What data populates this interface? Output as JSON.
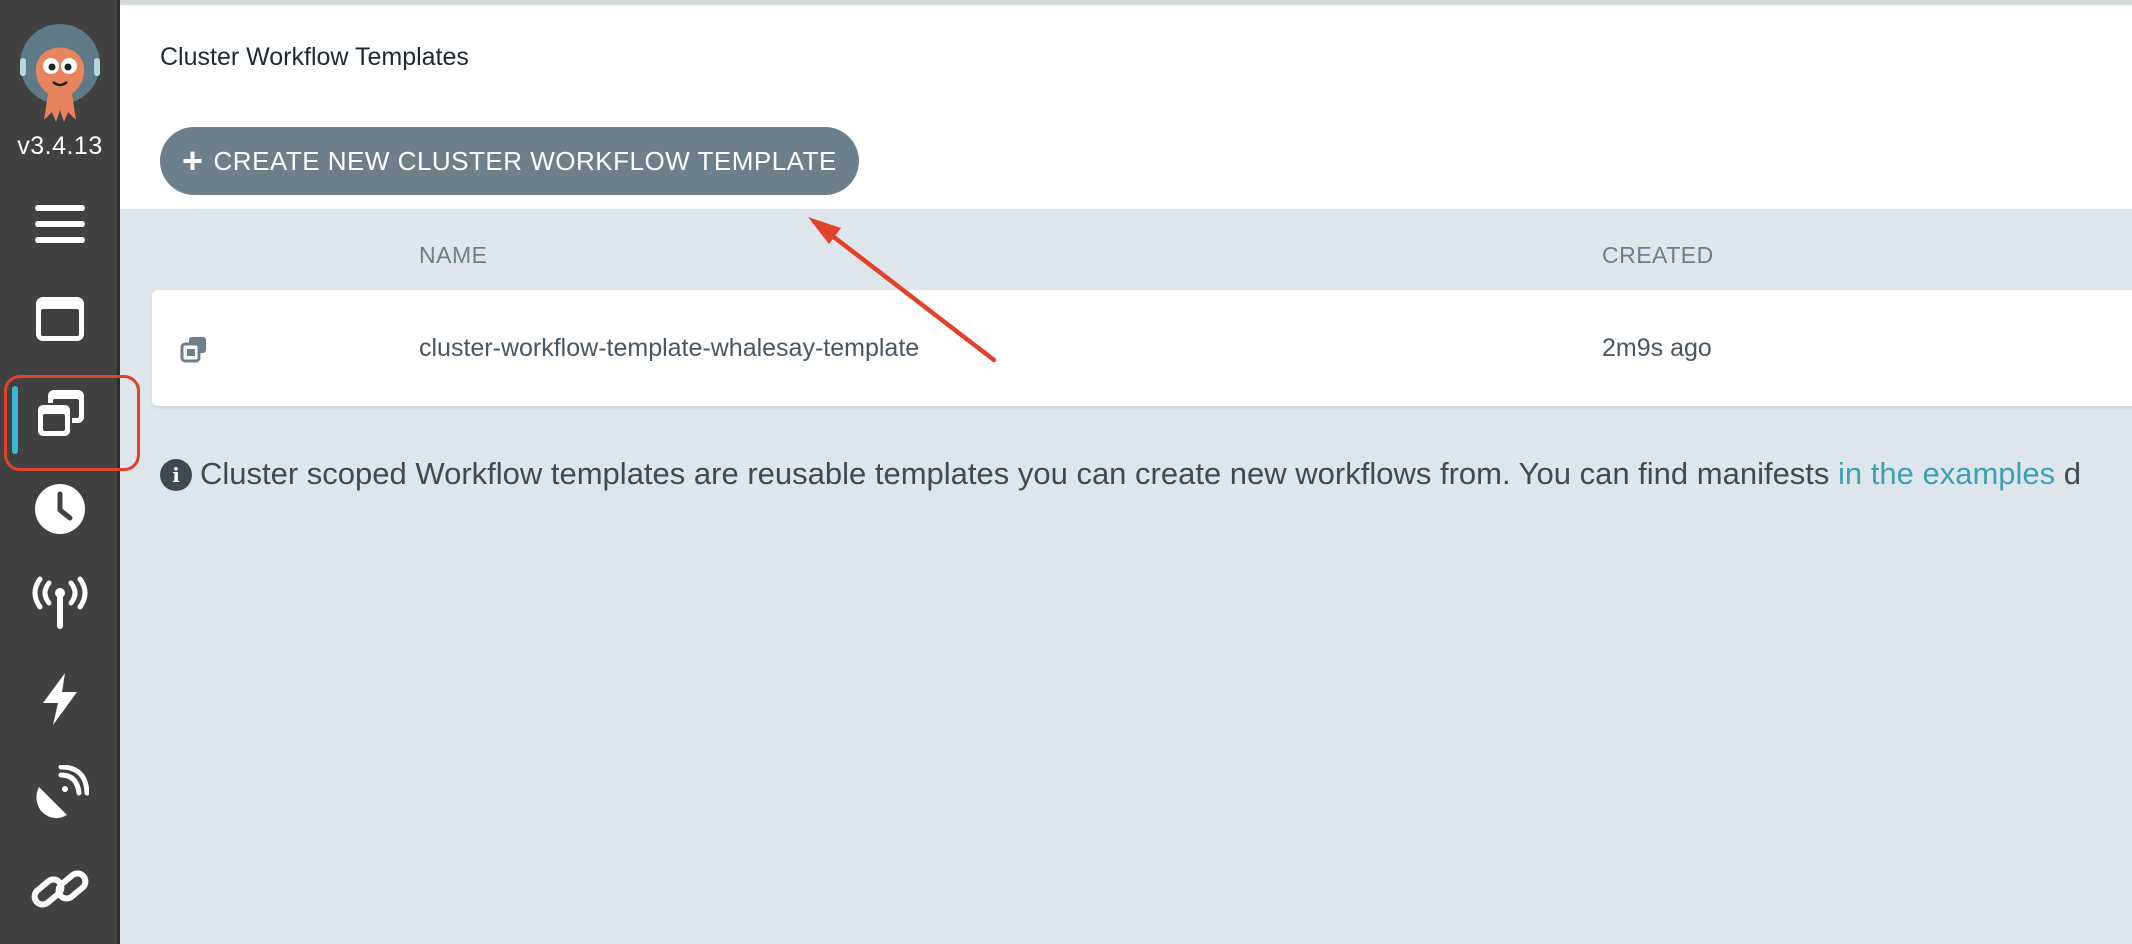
{
  "sidebar": {
    "version": "v3.4.13",
    "items": [
      {
        "icon": "menu-icon"
      },
      {
        "icon": "workflows-icon"
      },
      {
        "icon": "workflow-templates-icon",
        "active": true
      },
      {
        "icon": "clock-icon"
      },
      {
        "icon": "event-sources-icon"
      },
      {
        "icon": "sensors-icon"
      },
      {
        "icon": "satellite-dish-icon"
      },
      {
        "icon": "link-icon"
      }
    ]
  },
  "header": {
    "title": "Cluster Workflow Templates"
  },
  "toolbar": {
    "create_label": "CREATE NEW CLUSTER WORKFLOW TEMPLATE",
    "create_icon": "+"
  },
  "table": {
    "columns": [
      "NAME",
      "CREATED"
    ],
    "rows": [
      {
        "name": "cluster-workflow-template-whalesay-template",
        "created": "2m9s ago"
      }
    ]
  },
  "info": {
    "text": "Cluster scoped Workflow templates are reusable templates you can create new workflows from. You can find manifests ",
    "link_text": "in the examples",
    "trailing": " d"
  },
  "colors": {
    "sidebar_bg": "#414141",
    "accent": "#3fb6d3",
    "button_bg": "#6d7f8b",
    "annotation": "#e2412a",
    "link": "#3ba2b2"
  }
}
